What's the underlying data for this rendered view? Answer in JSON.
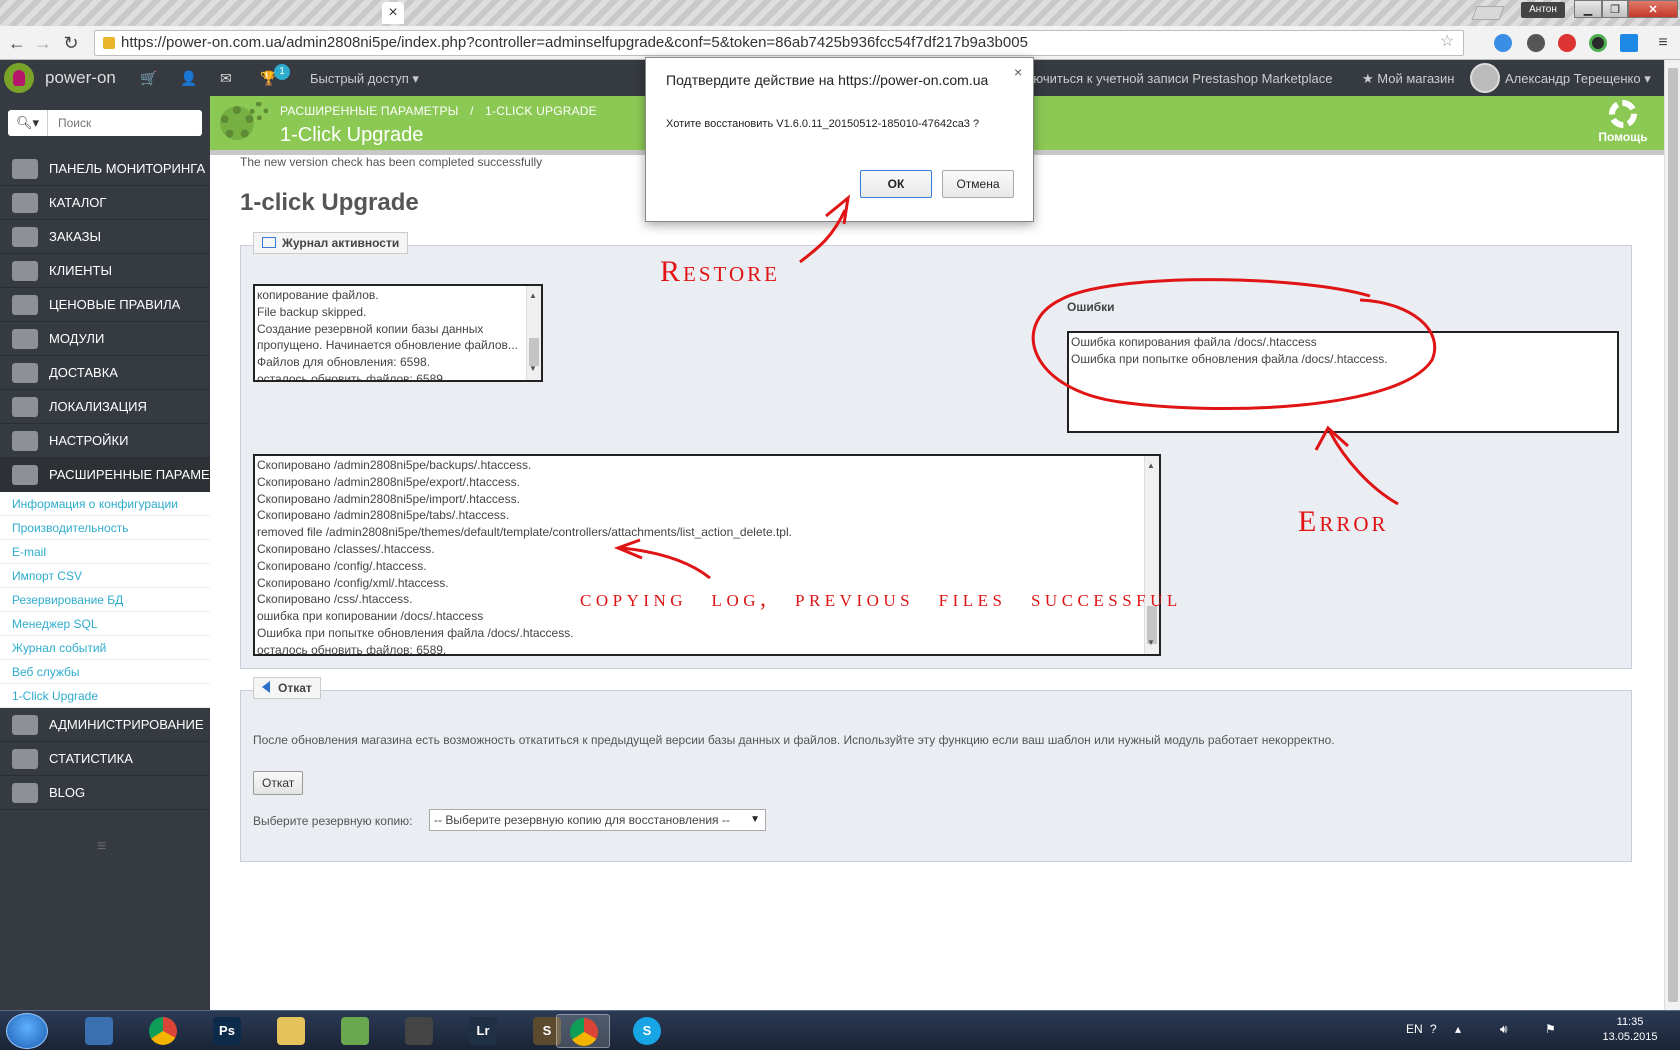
{
  "browser": {
    "url": "https://power-on.com.ua/admin2808ni5pe/index.php?controller=adminselfupgrade&conf=5&token=86ab7425b936fcc54f7df217b9a3b005",
    "tab_close": "×",
    "window_user": "Антон"
  },
  "header": {
    "brand": "power-on",
    "notification_count": "1",
    "quick_access": "Быстрый доступ ▾",
    "marketplace": "ключиться к учетной записи Prestashop Marketplace",
    "my_shop": "★ Мой магазин",
    "user_name": "Александр Терещенко ▾"
  },
  "sidebar": {
    "search_placeholder": "Поиск",
    "menu": [
      {
        "label": "ПАНЕЛЬ МОНИТОРИНГА",
        "icon": "dashboard-icon"
      },
      {
        "label": "КАТАЛОГ",
        "icon": "book-icon"
      },
      {
        "label": "ЗАКАЗЫ",
        "icon": "credit-card-icon"
      },
      {
        "label": "КЛИЕНТЫ",
        "icon": "users-icon"
      },
      {
        "label": "ЦЕНОВЫЕ ПРАВИЛА",
        "icon": "tag-icon"
      },
      {
        "label": "МОДУЛИ",
        "icon": "puzzle-icon"
      },
      {
        "label": "ДОСТАВКА",
        "icon": "truck-icon"
      },
      {
        "label": "ЛОКАЛИЗАЦИЯ",
        "icon": "globe-icon"
      },
      {
        "label": "НАСТРОЙКИ",
        "icon": "wrench-icon"
      },
      {
        "label": "РАСШИРЕННЫЕ ПАРАМЕ...",
        "icon": "gears-icon"
      }
    ],
    "submenu": [
      "Информация о конфигурации",
      "Производительность",
      "E-mail",
      "Импорт CSV",
      "Резервирование БД",
      "Менеджер SQL",
      "Журнал событий",
      "Веб службы",
      "1-Click Upgrade"
    ],
    "menu_after": [
      {
        "label": "АДМИНИСТРИРОВАНИЕ",
        "icon": "cog-icon"
      },
      {
        "label": "СТАТИСТИКА",
        "icon": "bar-chart-icon"
      },
      {
        "label": "BLOG",
        "icon": "pencil-icon"
      }
    ]
  },
  "page": {
    "breadcrumb_1": "РАСШИРЕННЫЕ ПАРАМЕТРЫ",
    "breadcrumb_sep": "/",
    "breadcrumb_2": "1-CLICK UPGRADE",
    "title": "1-Click Upgrade",
    "help": "Помощь",
    "success_msg": "The new version check has been completed successfully",
    "heading": "1-click Upgrade"
  },
  "activity_panel": {
    "legend": "Журнал активности",
    "small_log": [
      "копирование файлов.",
      "File backup skipped.",
      "Создание резервной копии базы данных",
      "пропущено. Начинается обновление файлов...",
      "Файлов для обновления: 6598.",
      "осталось обновить файлов: 6589 ."
    ],
    "errors_title": "Ошибки",
    "errors": [
      "Ошибка копирования файла /docs/.htaccess",
      "Ошибка при попытке обновления файла /docs/.htaccess."
    ],
    "big_log": [
      "Скопировано /admin2808ni5pe/backups/.htaccess.",
      "Скопировано /admin2808ni5pe/export/.htaccess.",
      "Скопировано /admin2808ni5pe/import/.htaccess.",
      "Скопировано /admin2808ni5pe/tabs/.htaccess.",
      "removed file /admin2808ni5pe/themes/default/template/controllers/attachments/list_action_delete.tpl.",
      "Скопировано /classes/.htaccess.",
      "Скопировано /config/.htaccess.",
      "Скопировано /config/xml/.htaccess.",
      "Скопировано /css/.htaccess.",
      "ошибка при копировании /docs/.htaccess",
      "Ошибка при попытке обновления файла /docs/.htaccess.",
      "осталось обновить файлов: 6589."
    ]
  },
  "rollback_panel": {
    "legend": "Откат",
    "description": "После обновления магазина есть возможность откатиться к предыдущей версии базы данных и файлов. Используйте эту функцию если ваш шаблон или нужный модуль работает некорректно.",
    "button": "Откат",
    "select_label": "Выберите резервную копию:",
    "select_value": "-- Выберите резервную копию для восстановления --"
  },
  "dialog": {
    "title": "Подтвердите действие на https://power-on.com.ua",
    "message": "Хотите восстановить V1.6.0.11_20150512-185010-47642ca3 ?",
    "ok": "ОК",
    "cancel": "Отмена",
    "close": "×"
  },
  "annotations": {
    "restore": "Restore",
    "error": "Error",
    "copying": "copying log, previous files successful",
    "color": "#e01414"
  },
  "taskbar": {
    "lang": "EN",
    "time": "11:35",
    "date": "13.05.2015",
    "apps": [
      {
        "icon": "ie-icon",
        "glyph": ""
      },
      {
        "icon": "chrome-icon",
        "glyph": ""
      },
      {
        "icon": "photoshop-icon",
        "glyph": "Ps"
      },
      {
        "icon": "explorer-icon",
        "glyph": ""
      },
      {
        "icon": "notepad-icon",
        "glyph": ""
      },
      {
        "icon": "camera-icon",
        "glyph": ""
      },
      {
        "icon": "lightroom-icon",
        "glyph": "Lr"
      },
      {
        "icon": "sublime-icon",
        "glyph": "S"
      },
      {
        "icon": "chrome-icon",
        "glyph": ""
      },
      {
        "icon": "skype-icon",
        "glyph": "S"
      }
    ]
  }
}
